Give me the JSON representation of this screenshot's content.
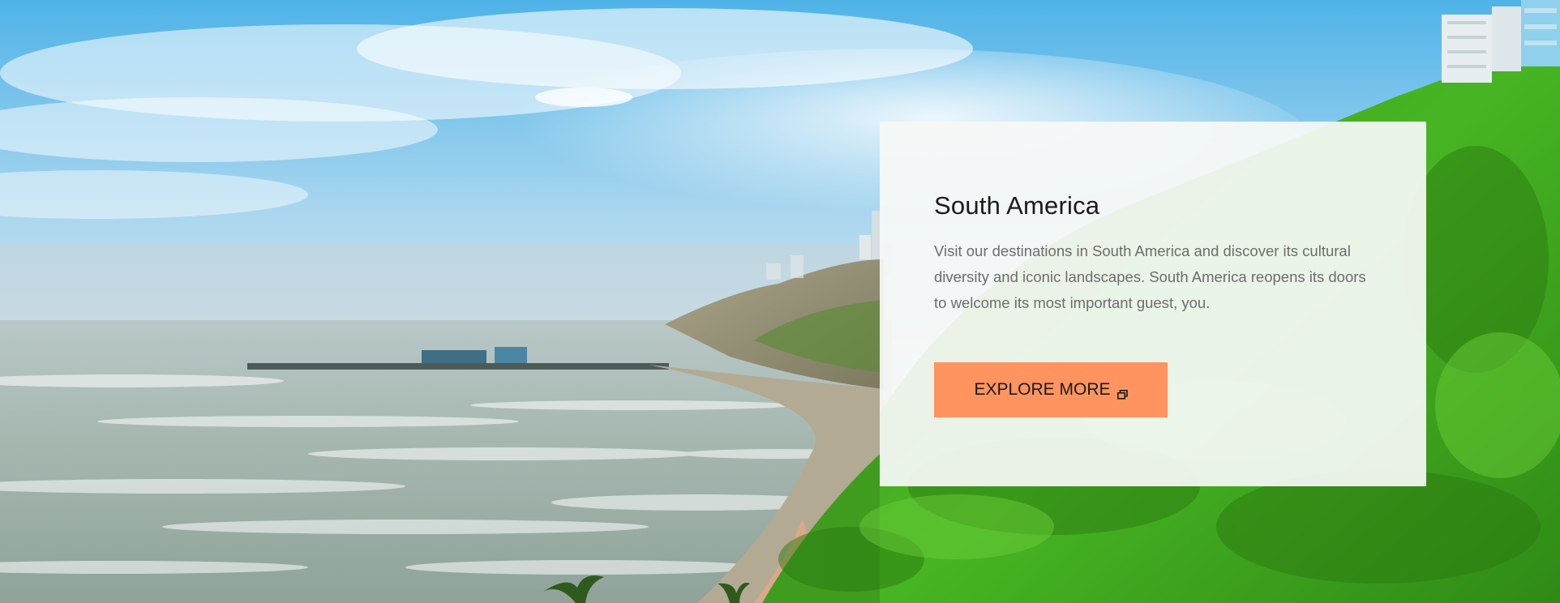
{
  "hero": {
    "title": "South America",
    "description": "Visit our destinations in South America and discover its cultural diversity and iconic landscapes. South America reopens its doors to welcome its most important guest, you.",
    "button_label": "EXPLORE MORE",
    "button_icon": "external-link-icon",
    "button_color": "#ff9460"
  }
}
